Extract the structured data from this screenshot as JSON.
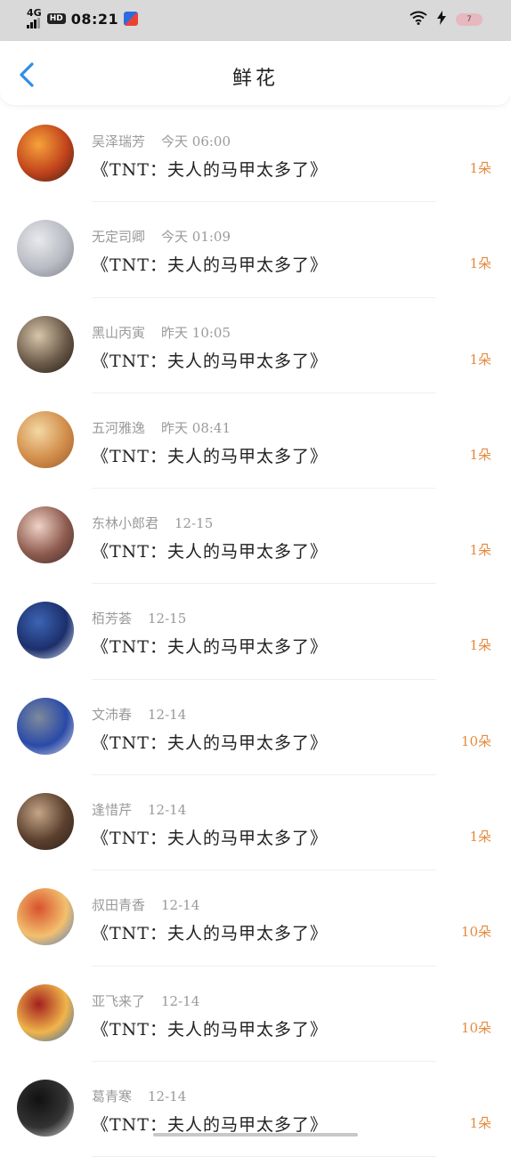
{
  "status_bar": {
    "network": "4G",
    "hd": "HD",
    "time": "08:21",
    "battery": "7"
  },
  "header": {
    "title": "鲜花"
  },
  "items": [
    {
      "name": "吴泽瑞芳",
      "time": "今天 06:00",
      "content": "《TNT：夫人的马甲太多了》",
      "count": "1朵",
      "avatar_colors": [
        "#f6a23a",
        "#c2441c",
        "#3b1e12"
      ]
    },
    {
      "name": "无定司卿",
      "time": "今天 01:09",
      "content": "《TNT：夫人的马甲太多了》",
      "count": "1朵",
      "avatar_colors": [
        "#e9e9ec",
        "#b9bcc4",
        "#7d7f86"
      ]
    },
    {
      "name": "黑山丙寅",
      "time": "昨天 10:05",
      "content": "《TNT：夫人的马甲太多了》",
      "count": "1朵",
      "avatar_colors": [
        "#d7c6ab",
        "#6b5a48",
        "#1f1a16"
      ]
    },
    {
      "name": "五河雅逸",
      "time": "昨天 08:41",
      "content": "《TNT：夫人的马甲太多了》",
      "count": "1朵",
      "avatar_colors": [
        "#f3d8a3",
        "#d28d4a",
        "#9a5a2c"
      ]
    },
    {
      "name": "东林小郎君",
      "time": "12-15",
      "content": "《TNT：夫人的马甲太多了》",
      "count": "1朵",
      "avatar_colors": [
        "#efd2c5",
        "#8e5b4f",
        "#3c2b2a"
      ]
    },
    {
      "name": "栢芳荟",
      "time": "12-15",
      "content": "《TNT：夫人的马甲太多了》",
      "count": "1朵",
      "avatar_colors": [
        "#3c64b4",
        "#1c2f6b",
        "#d9e2f4"
      ]
    },
    {
      "name": "文沛春",
      "time": "12-14",
      "content": "《TNT：夫人的马甲太多了》",
      "count": "10朵",
      "avatar_colors": [
        "#7e8a9c",
        "#2a4aa8",
        "#d8dce2"
      ]
    },
    {
      "name": "逢惜芹",
      "time": "12-14",
      "content": "《TNT：夫人的马甲太多了》",
      "count": "1朵",
      "avatar_colors": [
        "#c4a587",
        "#5a3f2d",
        "#2b211b"
      ]
    },
    {
      "name": "叔田青香",
      "time": "12-14",
      "content": "《TNT：夫人的马甲太多了》",
      "count": "10朵",
      "avatar_colors": [
        "#d9522e",
        "#f2c06e",
        "#4b7bc6"
      ]
    },
    {
      "name": "亚飞来了",
      "time": "12-14",
      "content": "《TNT：夫人的马甲太多了》",
      "count": "10朵",
      "avatar_colors": [
        "#a3201f",
        "#f0b54a",
        "#2b66b8"
      ]
    },
    {
      "name": "葛青寒",
      "time": "12-14",
      "content": "《TNT：夫人的马甲太多了》",
      "count": "1朵",
      "avatar_colors": [
        "#111111",
        "#333333",
        "#dddddd"
      ]
    }
  ]
}
